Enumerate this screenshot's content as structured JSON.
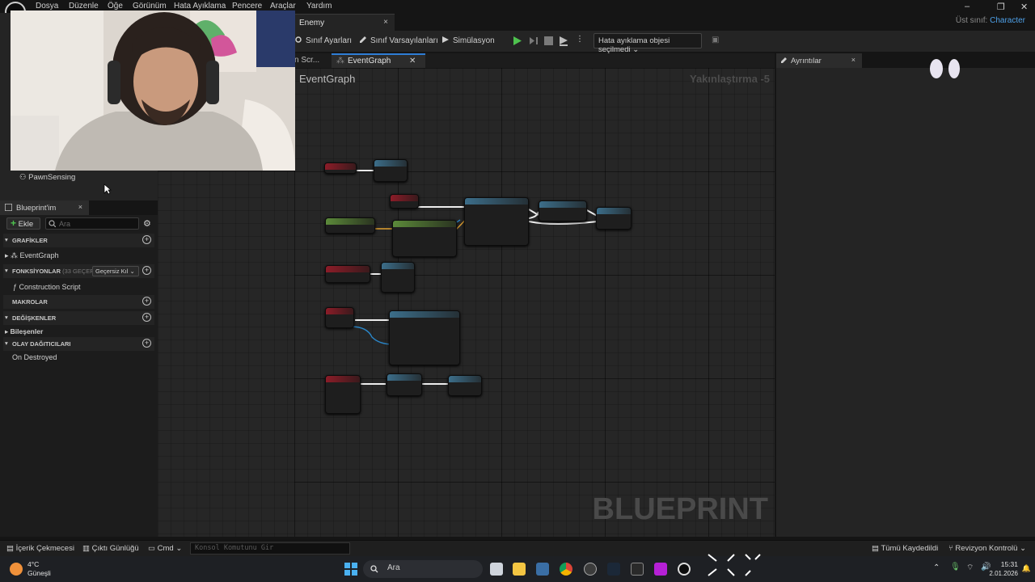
{
  "menu": [
    "Dosya",
    "Düzenle",
    "Öğe",
    "Görünüm",
    "Hata Ayıklama",
    "Pencere",
    "Araçlar",
    "Yardım"
  ],
  "parent_class": {
    "label": "Üst sınıf:",
    "value": "Character"
  },
  "document_tab": {
    "label": "Enemy",
    "close": "×"
  },
  "toolbar": {
    "class_settings": "Sınıf Ayarları",
    "class_defaults": "Sınıf Varsayılanları",
    "simulation": "Simülasyon",
    "debug_object": "Hata ayıklama objesi seçilmedi"
  },
  "graph": {
    "prev_tab": "n Scr...",
    "active_tab": "EventGraph",
    "title": "EventGraph",
    "zoom": "Yakınlaştırma -5",
    "watermark": "BLUEPRINT"
  },
  "details": {
    "tab": "Ayrıntılar",
    "close": "×"
  },
  "components": {
    "pawn_sensing": "PawnSensing"
  },
  "my_blueprint": {
    "tab": "Blueprint'im",
    "close": "×",
    "add": "Ekle",
    "search_placeholder": "Ara",
    "sections": {
      "graphs": "GRAFİKLER",
      "functions": "FONKSİYONLAR",
      "functions_count": "(33 GEÇERS",
      "override": "Geçersiz Kıl",
      "macros": "MAKROLAR",
      "variables": "DEĞİŞKENLER",
      "components": "Bileşenler",
      "dispatchers": "OLAY DAĞITICILARI"
    },
    "items": {
      "event_graph": "EventGraph",
      "construction_script": "Construction Script",
      "on_destroyed": "On Destroyed"
    }
  },
  "statusbar": {
    "content_drawer": "İçerik Çekmecesi",
    "output_log": "Çıktı Günlüğü",
    "cmd": "Cmd",
    "console_placeholder": "Konsol Komutunu Gir",
    "all_saved": "Tümü Kaydedildi",
    "revision_control": "Revizyon Kontrolü"
  },
  "taskbar": {
    "temperature": "4°C",
    "weather": "Güneşli",
    "search": "Ara",
    "time": "15:31",
    "date": "2.01.2026"
  },
  "colors": {
    "accent": "#2e7dd6",
    "play": "#4ec24e",
    "event_node": "#8c1c28",
    "function_node": "#3c6e8a"
  }
}
